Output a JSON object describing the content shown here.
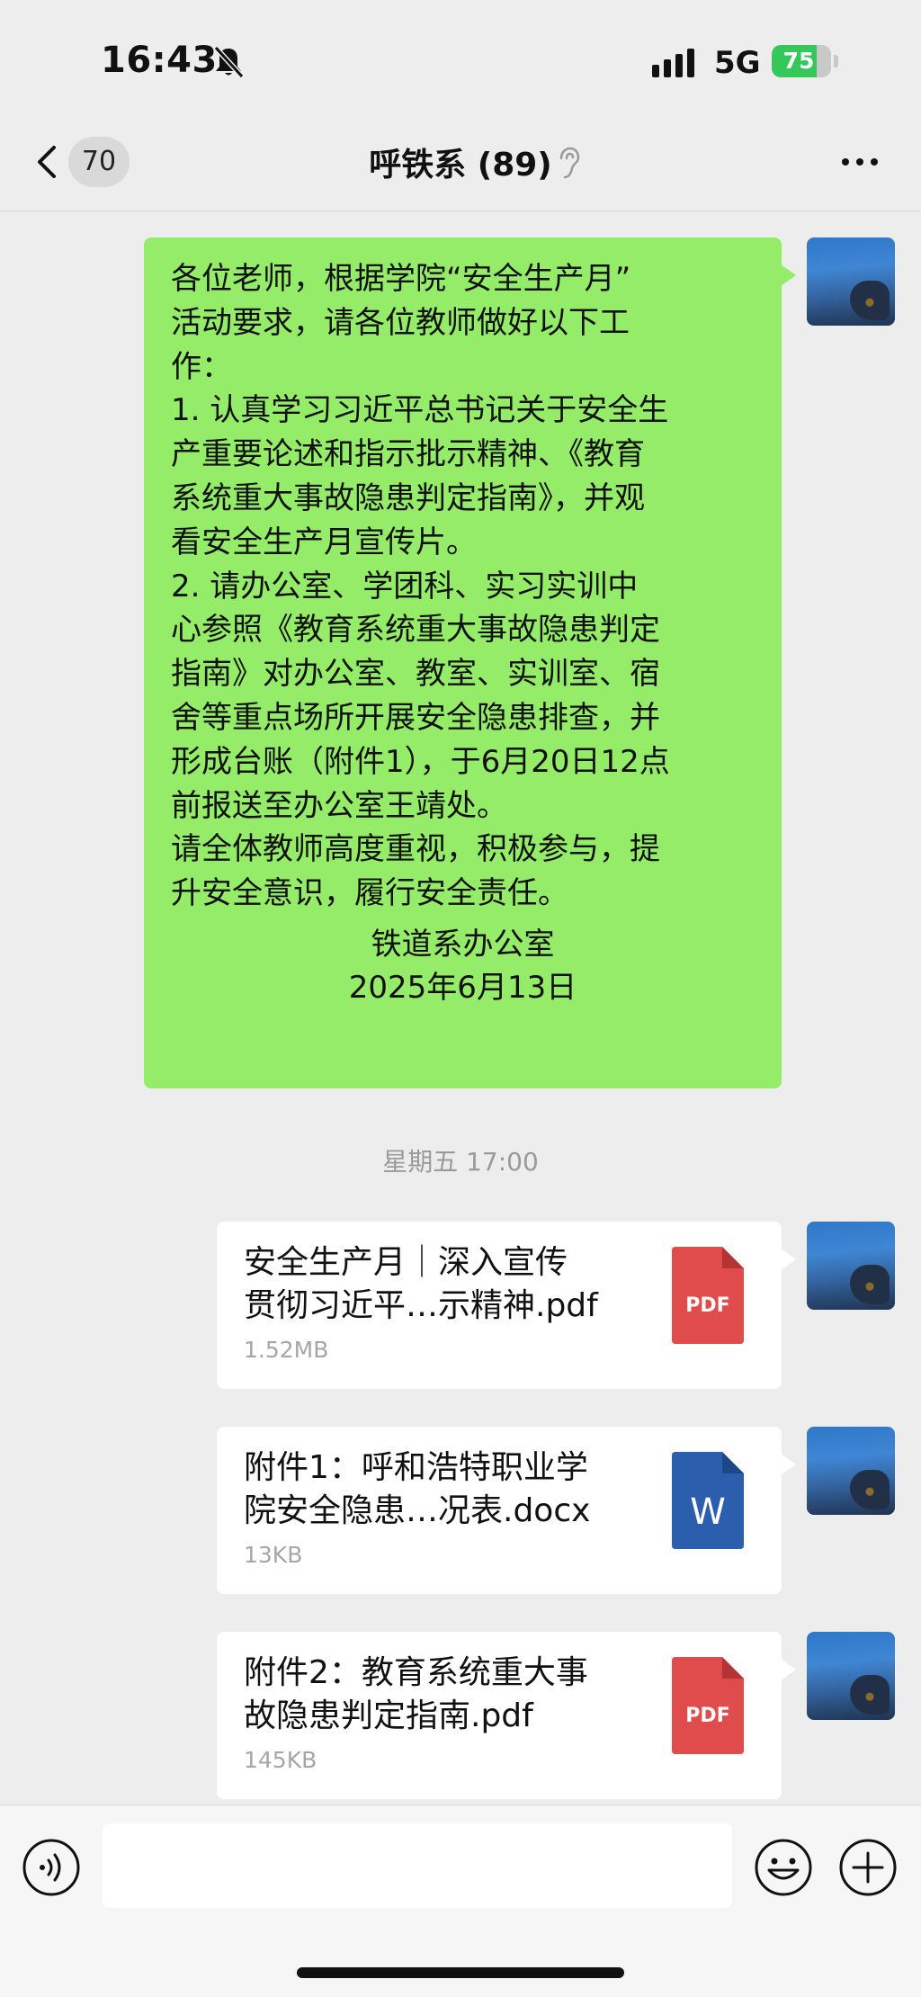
{
  "status_bar": {
    "time": "16:43",
    "network": "5G",
    "battery": "75",
    "battery_level": 0.75
  },
  "nav": {
    "unread_count": "70",
    "title": "呼铁系 (89)"
  },
  "message": {
    "body": "各位老师，根据学院“安全生产月”\n活动要求，请各位教师做好以下工\n作：\n1. 认真学习习近平总书记关于安全生\n产重要论述和指示批示精神、《教育\n系统重大事故隐患判定指南》，并观\n看安全生产月宣传片。\n2. 请办公室、学团科、实习实训中\n心参照《教育系统重大事故隐患判定\n指南》对办公室、教室、实训室、宿\n舍等重点场所开展安全隐患排查，并\n形成台账（附件1），于6月20日12点\n前报送至办公室王靖处。\n请全体教师高度重视，积极参与，提\n升安全意识，履行安全责任。",
    "sign_dept": "铁道系办公室",
    "sign_date": "2025年6月13日"
  },
  "timestamp": "星期五 17:00",
  "files": [
    {
      "name": "安全生产月｜深入宣传\n贯彻习近平…示精神.pdf",
      "size": "1.52MB",
      "type": "PDF",
      "color": "#e04b4b"
    },
    {
      "name": "附件1：呼和浩特职业学\n院安全隐患…况表.docx",
      "size": "13KB",
      "type": "W",
      "color": "#2b5fae"
    },
    {
      "name": "附件2：教育系统重大事\n故隐患判定指南.pdf",
      "size": "145KB",
      "type": "PDF",
      "color": "#e04b4b"
    }
  ],
  "input": {
    "placeholder": ""
  }
}
